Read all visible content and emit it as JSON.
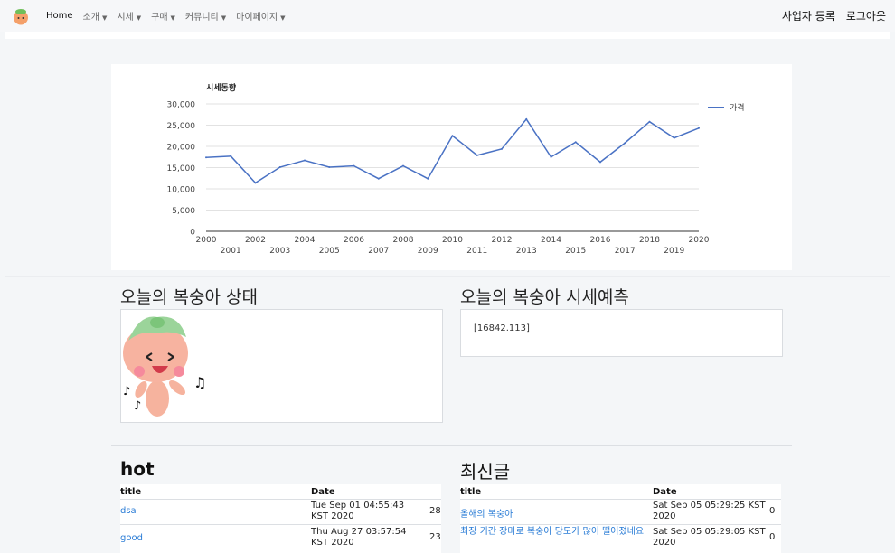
{
  "nav": {
    "home": "Home",
    "items": [
      "소개",
      "시세",
      "구매",
      "커뮤니티",
      "마이페이지"
    ],
    "right": [
      "사업자 등록",
      "로그아웃"
    ]
  },
  "colors": {
    "line": "#4a72c4",
    "link": "#2a7cd6",
    "peach": "#f4a88e"
  },
  "chart_data": {
    "type": "line",
    "title": "시세동향",
    "x": [
      2000,
      2001,
      2002,
      2003,
      2004,
      2005,
      2006,
      2007,
      2008,
      2009,
      2010,
      2011,
      2012,
      2013,
      2014,
      2015,
      2016,
      2017,
      2018,
      2019,
      2020
    ],
    "series": [
      {
        "name": "가격",
        "values": [
          17400,
          17700,
          11400,
          15100,
          16700,
          15100,
          15400,
          12400,
          15400,
          12400,
          22500,
          17900,
          19400,
          26400,
          17500,
          21000,
          16300,
          20800,
          25800,
          22000,
          24300
        ]
      }
    ],
    "ylim": [
      0,
      30000
    ],
    "yticks": [
      "0",
      "5,000",
      "10,000",
      "15,000",
      "20,000",
      "25,000",
      "30,000"
    ],
    "legend": "right"
  },
  "status": {
    "title": "오늘의 복숭아 상태",
    "image": "peach-character"
  },
  "prediction": {
    "title": "오늘의 복숭아 시세예측",
    "value": "[16842.113]"
  },
  "hot": {
    "title": "hot",
    "headers": [
      "title",
      "Date"
    ],
    "rows": [
      {
        "title": "dsa",
        "date": "Tue Sep 01 04:55:43 KST 2020",
        "count": "28"
      },
      {
        "title": "good",
        "date": "Thu Aug 27 03:57:54 KST 2020",
        "count": "23"
      }
    ]
  },
  "latest": {
    "title": "최신글",
    "headers": [
      "title",
      "Date"
    ],
    "rows": [
      {
        "title": "올해의 복숭아",
        "date": "Sat Sep 05 05:29:25 KST 2020",
        "count": "0"
      },
      {
        "title": "최장 기간 장마로 복숭아 당도가 많이 떨어졌네요",
        "date": "Sat Sep 05 05:29:05 KST 2020",
        "count": "0"
      }
    ]
  }
}
